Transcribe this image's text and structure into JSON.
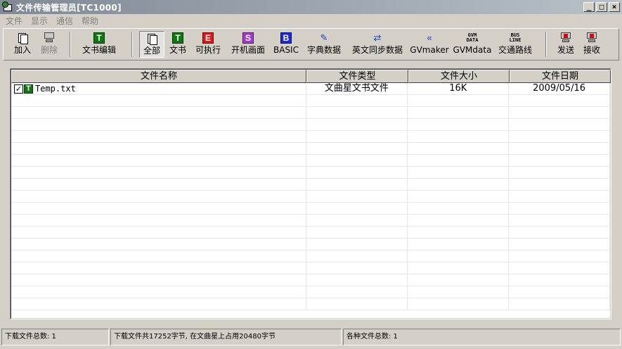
{
  "window": {
    "title": "文件传输管理员[TC1000]",
    "controls": [
      "_",
      "□",
      "×"
    ]
  },
  "menu": [
    {
      "label": "文件"
    },
    {
      "label": "显示"
    },
    {
      "label": "通信"
    },
    {
      "label": "帮助"
    }
  ],
  "toolbar": {
    "add": {
      "label": "加入",
      "icon": "document-stack-icon"
    },
    "delete": {
      "label": "删除",
      "icon": "computer-icon",
      "enabled": false
    },
    "text_edit": {
      "label": "文书编辑",
      "icon_letter": "T"
    },
    "all": {
      "label": "全部",
      "icon": "document-stack-icon",
      "pressed": true
    },
    "text": {
      "label": "文书",
      "icon_letter": "T"
    },
    "exec": {
      "label": "可执行",
      "icon_letter": "E"
    },
    "boot": {
      "label": "开机画面",
      "icon_letter": "S"
    },
    "basic": {
      "label": "BASIC",
      "icon_letter": "B"
    },
    "dict": {
      "label": "字典数据",
      "icon": "dictionary-icon"
    },
    "ensync": {
      "label": "英文同步数据",
      "icon": "sync-icon"
    },
    "gvmaker": {
      "label": "GVmaker",
      "icon": "gvmaker-icon"
    },
    "gvmdata": {
      "label": "GVMdata",
      "icon_text_1": "GVM",
      "icon_text_2": "DATA"
    },
    "bus": {
      "label": "交通路线",
      "icon_text_1": "BUS",
      "icon_text_2": "LINE"
    },
    "send": {
      "label": "发送",
      "icon": "send-icon"
    },
    "receive": {
      "label": "接收",
      "icon": "receive-icon"
    }
  },
  "list": {
    "columns": [
      "文件名称",
      "文件类型",
      "文件大小",
      "文件日期"
    ],
    "rows": [
      {
        "checked": true,
        "type_letter": "T",
        "name": "Temp.txt",
        "type": "文曲星文书文件",
        "size": "16K",
        "date": "2009/05/16"
      }
    ],
    "empty_rows": 18
  },
  "status": {
    "download_total": "下载文件总数: 1",
    "download_bytes": "下载文件共17252字节, 在文曲星上占用20480字节",
    "type_total": "各种文件总数: 1"
  },
  "colors": {
    "face": "#d4d0c8",
    "title_gradient_start": "#7f8a96",
    "text_icon_green": "#0b7a0b",
    "exec_icon_red": "#e01818",
    "boot_icon_purple": "#a43ad0",
    "basic_icon_blue": "#1a2ad8"
  }
}
